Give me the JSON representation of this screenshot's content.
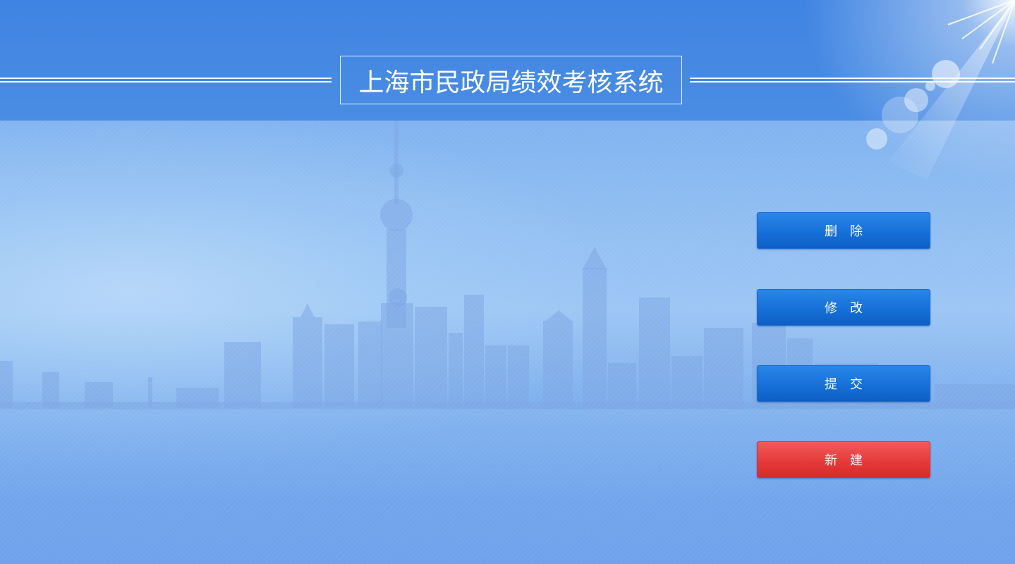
{
  "header": {
    "title": "上海市民政局绩效考核系统"
  },
  "actions": {
    "delete_label": "删除",
    "modify_label": "修改",
    "submit_label": "提交",
    "new_label": "新建"
  },
  "icons": {
    "sun_flare": "sun-flare-icon",
    "skyline": "city-skyline-illustration"
  },
  "colors": {
    "header_blue": "#4a8de4",
    "button_blue": "#1670d8",
    "button_red": "#e53b3b",
    "title_text": "#ffffff"
  }
}
